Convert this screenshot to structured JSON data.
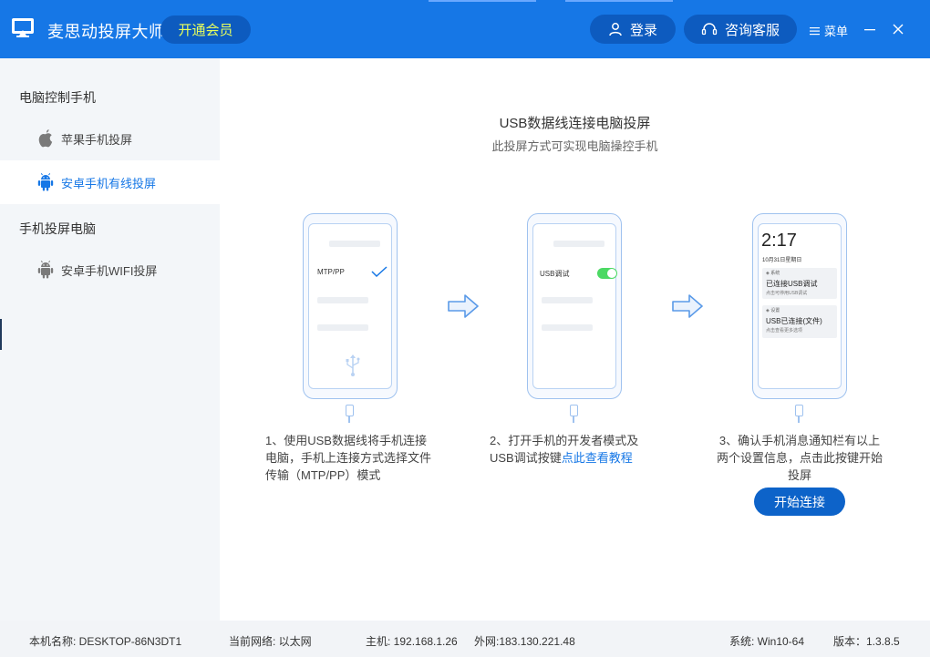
{
  "app": {
    "title": "麦思动投屏大师",
    "vip_label": "开通会员",
    "login_label": "登录",
    "service_label": "咨询客服",
    "menu_label": "菜单"
  },
  "sidebar": {
    "section1": "电脑控制手机",
    "item_iphone": "苹果手机投屏",
    "item_android_wired": "安卓手机有线投屏",
    "section2": "手机投屏电脑",
    "item_android_wifi": "安卓手机WIFI投屏"
  },
  "main": {
    "title": "USB数据线连接电脑投屏",
    "subtitle": "此投屏方式可实现电脑操控手机",
    "phone1": {
      "mode_label": "MTP/PP"
    },
    "phone2": {
      "usb_debug_label": "USB调试"
    },
    "phone3": {
      "clock": "2:17",
      "date": "10月31日星期日",
      "notif1_src": "系统",
      "notif1_title": "已连接USB调试",
      "notif1_desc": "点击可停用USB调试",
      "notif2_src": "设置",
      "notif2_title": "USB已连接(文件)",
      "notif2_desc": "点击查看更多选项"
    },
    "step1_text": "1、使用USB数据线将手机连接电脑，手机上连接方式选择文件传输（MTP/PP）模式",
    "step2_text": "2、打开手机的开发者模式及USB调试按键",
    "step2_link": "点此查看教程",
    "step3_text": "3、确认手机消息通知栏有以上两个设置信息，点击此按键开始投屏",
    "start_button": "开始连接"
  },
  "status": {
    "computer_name": "本机名称: DESKTOP-86N3DT1",
    "network": "当前网络: 以太网",
    "host_ip": "主机: 192.168.1.26",
    "external_ip": "外网:183.130.221.48",
    "system": "系统: Win10-64",
    "version": "版本：1.3.8.5"
  },
  "colors": {
    "brand": "#1677e6",
    "button_dark": "#0d5bbf",
    "vip_text": "#e8ff5c",
    "sidebar_bg": "#f3f6f9"
  }
}
